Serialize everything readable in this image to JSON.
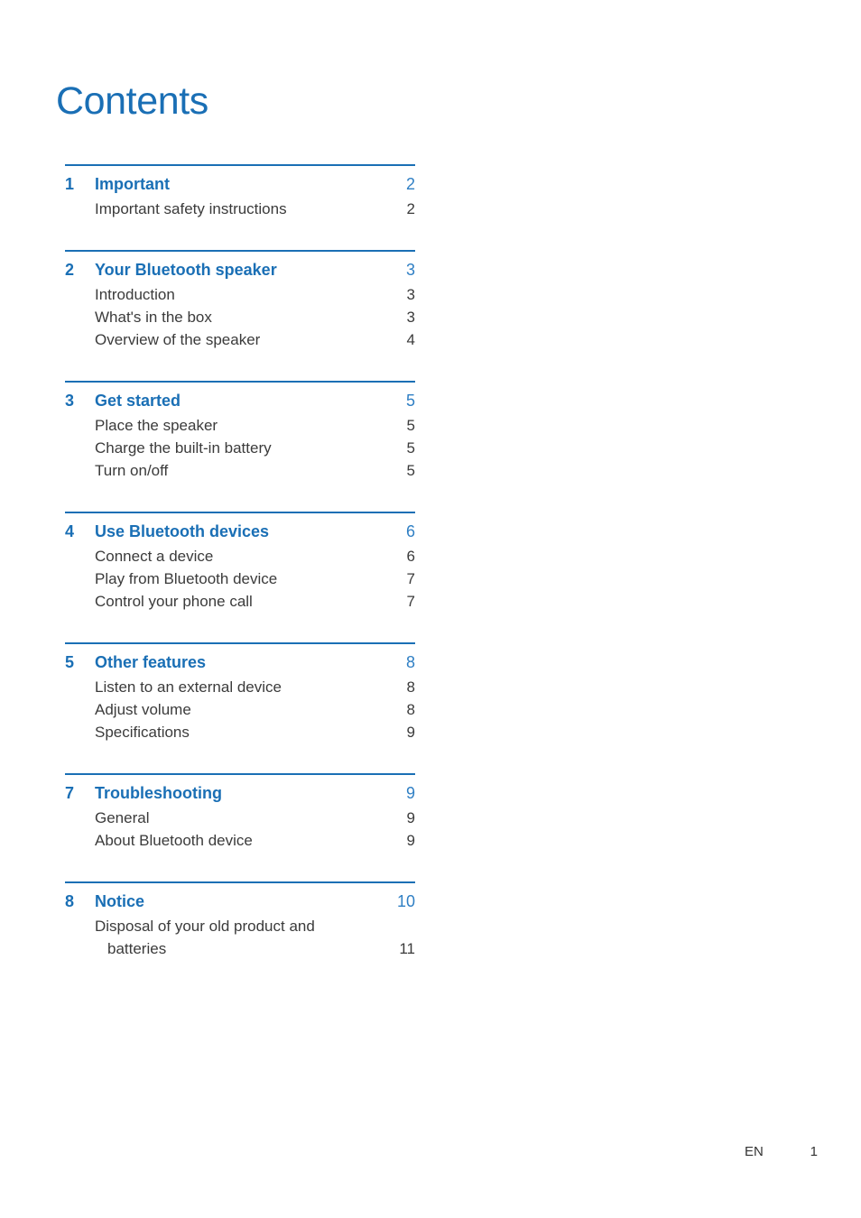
{
  "document": {
    "title": "Contents",
    "accent_color": "#1a6fb5",
    "body_color": "#3b3b3b",
    "page_number_color": "#2f7fc4"
  },
  "toc": {
    "groups": [
      {
        "number": "1",
        "title": "Important",
        "page": "2",
        "items": [
          {
            "title": "Important safety instructions",
            "page": "2",
            "continuation": false
          }
        ]
      },
      {
        "number": "2",
        "title": "Your Bluetooth speaker",
        "page": "3",
        "items": [
          {
            "title": "Introduction",
            "page": "3",
            "continuation": false
          },
          {
            "title": "What's in the box",
            "page": "3",
            "continuation": false
          },
          {
            "title": "Overview of the speaker",
            "page": "4",
            "continuation": false
          }
        ]
      },
      {
        "number": "3",
        "title": "Get started",
        "page": "5",
        "items": [
          {
            "title": "Place the speaker",
            "page": "5",
            "continuation": false
          },
          {
            "title": "Charge the built-in battery",
            "page": "5",
            "continuation": false
          },
          {
            "title": "Turn on/off",
            "page": "5",
            "continuation": false
          }
        ]
      },
      {
        "number": "4",
        "title": "Use Bluetooth devices",
        "page": "6",
        "items": [
          {
            "title": "Connect a device",
            "page": "6",
            "continuation": false
          },
          {
            "title": "Play from Bluetooth device",
            "page": "7",
            "continuation": false
          },
          {
            "title": "Control your phone call",
            "page": "7",
            "continuation": false
          }
        ]
      },
      {
        "number": "5",
        "title": "Other features",
        "page": "8",
        "items": [
          {
            "title": "Listen to an external device",
            "page": "8",
            "continuation": false
          },
          {
            "title": "Adjust volume",
            "page": "8",
            "continuation": false
          },
          {
            "title": "Specifications",
            "page": "9",
            "continuation": false
          }
        ]
      },
      {
        "number": "7",
        "title": "Troubleshooting",
        "page": "9",
        "items": [
          {
            "title": "General",
            "page": "9",
            "continuation": false
          },
          {
            "title": "About Bluetooth device",
            "page": "9",
            "continuation": false
          }
        ]
      },
      {
        "number": "8",
        "title": "Notice",
        "page": "10",
        "items": [
          {
            "title": "Disposal of your old product and",
            "page": "",
            "continuation": false
          },
          {
            "title": "batteries",
            "page": "11",
            "continuation": true
          }
        ]
      }
    ]
  },
  "footer": {
    "language": "EN",
    "page_number": "1"
  }
}
